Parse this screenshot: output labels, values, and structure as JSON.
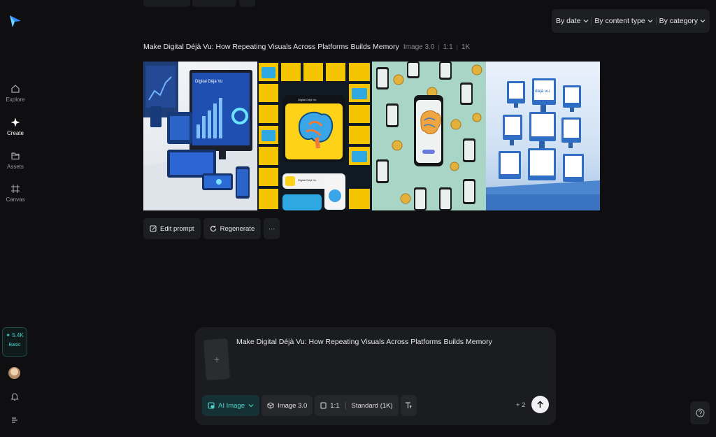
{
  "nav": {
    "items": [
      {
        "label": "Explore",
        "icon": "home-icon"
      },
      {
        "label": "Create",
        "icon": "sparkle-icon"
      },
      {
        "label": "Assets",
        "icon": "folder-icon"
      },
      {
        "label": "Canvas",
        "icon": "canvas-icon"
      }
    ],
    "credits": {
      "amount": "✦ 5.4K",
      "plan": "Basic"
    }
  },
  "filters": [
    "By date",
    "By content type",
    "By category"
  ],
  "generation": {
    "title": "Make Digital Déjà Vu: How Repeating Visuals Across Platforms Builds Memory",
    "model": "Image 3.0",
    "ratio": "1:1",
    "resolution": "1K",
    "image_texts": {
      "img1_screen": "Digital Déjà Vu",
      "img2_header": "Digital Déjà Vu",
      "img2_card": "Digital Déjà Vu",
      "img4_label": "déjà vu"
    }
  },
  "actions": {
    "edit_prompt": "Edit prompt",
    "regenerate": "Regenerate",
    "more": "···"
  },
  "composer": {
    "prompt": "Make Digital Déjà Vu: How Repeating Visuals Across Platforms Builds Memory",
    "thumb_glyph": "+",
    "mode": "AI Image",
    "model": "Image 3.0",
    "ratio": "1:1",
    "quality": "Standard (1K)",
    "extra_count": "+ 2"
  },
  "colors": {
    "background": "#0f0f11",
    "accent": "#4fd6cf",
    "panel": "#1d1e21"
  }
}
